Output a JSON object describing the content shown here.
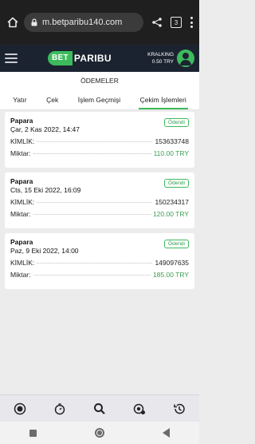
{
  "browser": {
    "url": "m.betparibu140.com",
    "tabs_count": "3",
    "icons": [
      "home-icon",
      "lock-icon",
      "share-icon",
      "tabs-icon",
      "more-icon"
    ]
  },
  "header": {
    "logo_bet": "BET",
    "logo_paribu": "PARIBU",
    "username": "KRALKING",
    "balance": "0.50 TRY",
    "colors": {
      "brand_green": "#3dbb5c",
      "header_bg": "#1c2330"
    }
  },
  "page": {
    "title": "ÖDEMELER",
    "tabs": [
      {
        "label": "Yatır"
      },
      {
        "label": "Çek"
      },
      {
        "label": "İşlem Geçmişi"
      },
      {
        "label": "Çekim İşlemleri",
        "active": true
      }
    ]
  },
  "withdrawals": [
    {
      "method": "Papara",
      "date": "Çar, 2 Kas 2022, 14:47",
      "status": "Ödendi",
      "id_label": "KİMLİK:",
      "id": "153633748",
      "amount_label": "Miktar:",
      "amount": "110.00 TRY"
    },
    {
      "method": "Papara",
      "date": "Cts, 15 Eki 2022, 16:09",
      "status": "Ödendi",
      "id_label": "KİMLİK:",
      "id": "150234317",
      "amount_label": "Miktar:",
      "amount": "120.00 TRY"
    },
    {
      "method": "Papara",
      "date": "Paz, 9 Eki 2022, 14:00",
      "status": "Ödendi",
      "id_label": "KİMLİK:",
      "id": "149097635",
      "amount_label": "Miktar:",
      "amount": "185.00 TRY"
    }
  ],
  "bottom_nav": [
    "live-icon",
    "stopwatch-icon",
    "search-icon",
    "shield-badge-icon",
    "history-icon"
  ]
}
